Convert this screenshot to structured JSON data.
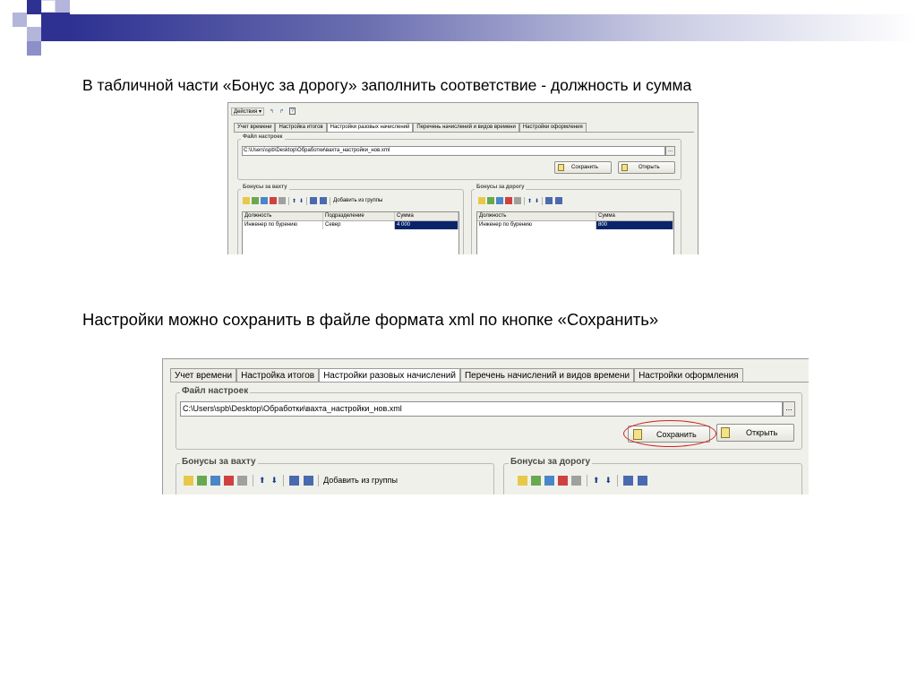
{
  "slide": {
    "caption_top": "В табличной части «Бонус за дорогу» заполнить соответствие - должность и сумма",
    "caption_bottom": "Настройки можно сохранить в файле формата xml по кнопке «Сохранить»",
    "colors": {
      "accent": "#2e3192",
      "selection": "#0a246a",
      "highlight_circle": "#d02020"
    }
  },
  "window": {
    "menu": {
      "actions": "Действия",
      "dropdown_icon": "triangle-down-icon",
      "icons": [
        "arrow-icon",
        "arrow-icon",
        "help-icon"
      ]
    },
    "tabs": [
      "Учет времени",
      "Настройка итогов",
      "Настройки разовых начислений",
      "Перечень начислений и видов времени",
      "Настройки оформления"
    ],
    "active_tab": "Настройки разовых начислений",
    "settings_file": {
      "title": "Файл настроек",
      "path": "C:\\Users\\spb\\Desktop\\Обработки\\вахта_настройки_нов.xml",
      "browse": "...",
      "save": "Сохранить",
      "open": "Открыть"
    },
    "bonus_shift": {
      "title": "Бонусы за вахту",
      "add_from_group": "Добавить из группы",
      "columns": [
        "Должность",
        "Подразделение",
        "Сумма"
      ],
      "rows": [
        [
          "Инженер по бурению",
          "Север",
          "4 000"
        ]
      ]
    },
    "bonus_road": {
      "title": "Бонусы за дорогу",
      "columns": [
        "Должность",
        "Сумма"
      ],
      "rows": [
        [
          "Инженер по бурению",
          "800"
        ]
      ]
    }
  }
}
